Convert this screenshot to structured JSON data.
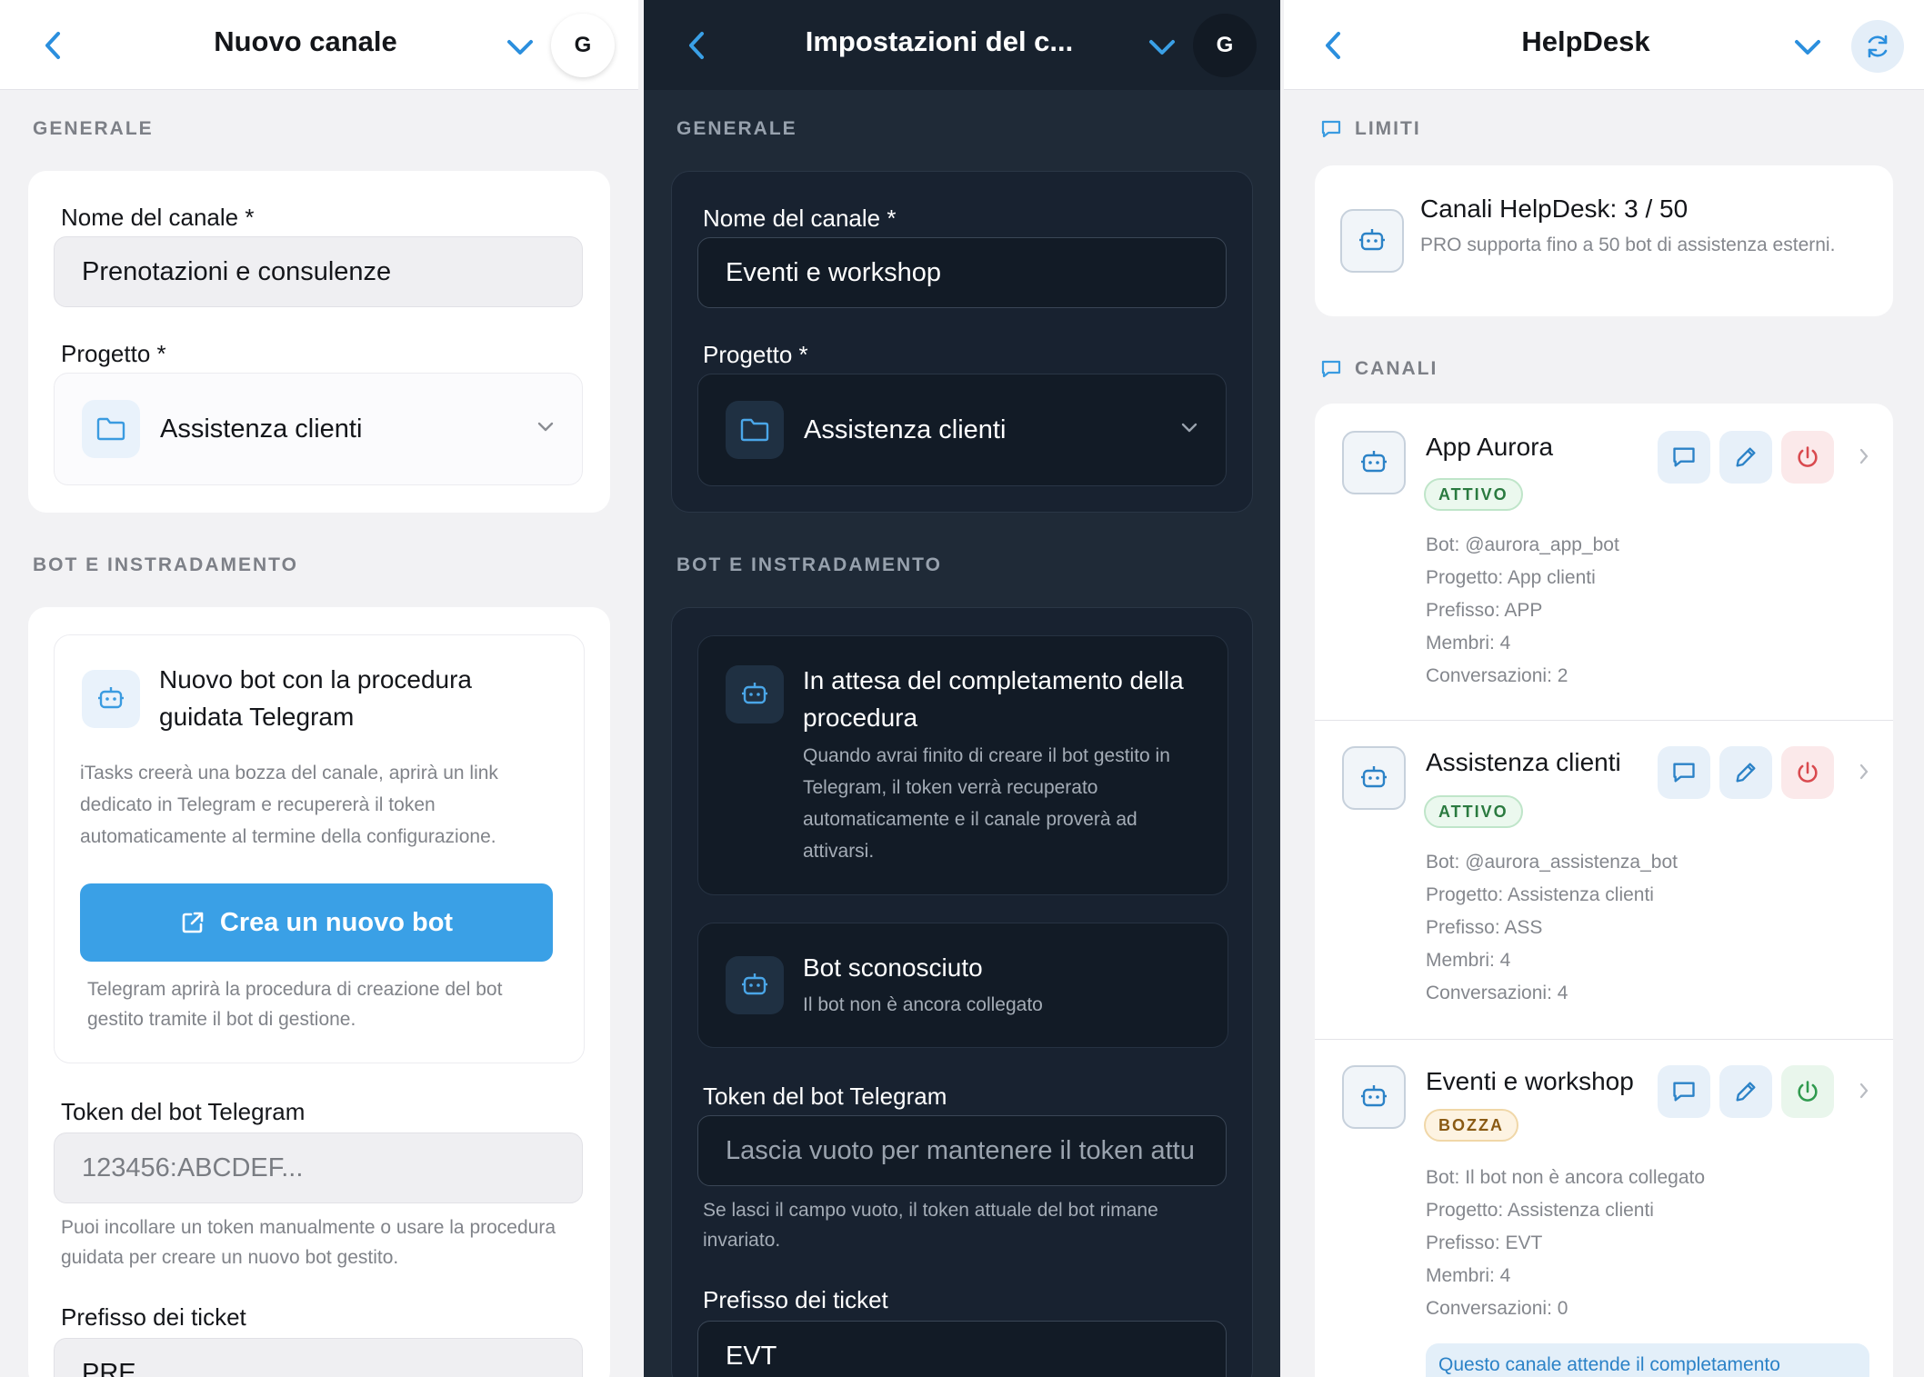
{
  "screen1": {
    "title": "Nuovo canale",
    "avatar": "G",
    "section_general": "GENERALE",
    "name_label": "Nome del canale *",
    "name_value": "Prenotazioni e consulenze",
    "project_label": "Progetto *",
    "project_value": "Assistenza clienti",
    "section_bot": "BOT E INSTRADAMENTO",
    "wizard_title": "Nuovo bot con la procedura guidata Telegram",
    "wizard_desc": "iTasks creerà una bozza del canale, aprirà un link dedicato in Telegram e recupererà il token automaticamente al termine della configurazione.",
    "create_button": "Crea un nuovo bot",
    "create_help": "Telegram aprirà la procedura di creazione del bot gestito tramite il bot di gestione.",
    "token_label": "Token del bot Telegram",
    "token_placeholder": "123456:ABCDEF...",
    "token_help": "Puoi incollare un token manualmente o usare la procedura guidata per creare un nuovo bot gestito.",
    "prefix_label": "Prefisso dei ticket",
    "prefix_value": "PRE"
  },
  "screen2": {
    "title": "Impostazioni del c...",
    "avatar": "G",
    "section_general": "GENERALE",
    "name_label": "Nome del canale *",
    "name_value": "Eventi e workshop",
    "project_label": "Progetto *",
    "project_value": "Assistenza clienti",
    "section_bot": "BOT E INSTRADAMENTO",
    "pending_title": "In attesa del completamento della procedura",
    "pending_desc": "Quando avrai finito di creare il bot gestito in Telegram, il token verrà recuperato automaticamente e il canale proverà ad attivarsi.",
    "unknown_title": "Bot sconosciuto",
    "unknown_desc": "Il bot non è ancora collegato",
    "token_label": "Token del bot Telegram",
    "token_placeholder": "Lascia vuoto per mantenere il token attu",
    "token_help": "Se lasci il campo vuoto, il token attuale del bot rimane invariato.",
    "prefix_label": "Prefisso dei ticket",
    "prefix_value": "EVT"
  },
  "screen3": {
    "title": "HelpDesk",
    "section_limits": "LIMITI",
    "limit_title": "Canali HelpDesk: 3 / 50",
    "limit_desc": "PRO supporta fino a 50 bot di assistenza esterni.",
    "section_channels": "CANALI",
    "channels": [
      {
        "name": "App Aurora",
        "status": "ATTIVO",
        "bot": "Bot: @aurora_app_bot",
        "project": "Progetto: App clienti",
        "prefix": "Prefisso: APP",
        "members": "Membri: 4",
        "conversations": "Conversazioni: 2"
      },
      {
        "name": "Assistenza clienti",
        "status": "ATTIVO",
        "bot": "Bot: @aurora_assistenza_bot",
        "project": "Progetto: Assistenza clienti",
        "prefix": "Prefisso: ASS",
        "members": "Membri: 4",
        "conversations": "Conversazioni: 4"
      },
      {
        "name": "Eventi e workshop",
        "status": "BOZZA",
        "bot": "Bot: Il bot non è ancora collegato",
        "project": "Progetto: Assistenza clienti",
        "prefix": "Prefisso: EVT",
        "members": "Membri: 4",
        "conversations": "Conversazioni: 0",
        "notice": "Questo canale attende il completamento"
      }
    ]
  },
  "colors": {
    "accent": "#3aa0e6",
    "dark_bg": "#1f2a37",
    "active_green": "#2a7a3f",
    "draft_amber": "#8a5a14",
    "danger_red": "#d94a4f"
  },
  "icons": [
    "chevron-left-icon",
    "chevron-down-icon",
    "folder-icon",
    "robot-icon",
    "external-link-icon",
    "chat-bubble-icon",
    "pencil-icon",
    "power-icon",
    "refresh-icon",
    "chevron-right-icon"
  ]
}
